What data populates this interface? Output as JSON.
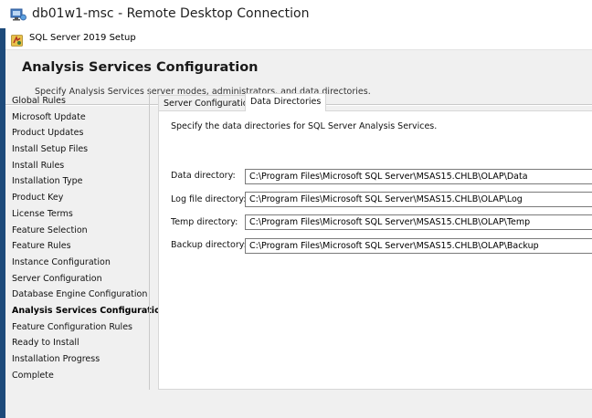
{
  "rdp": {
    "title": "db01w1-msc - Remote Desktop Connection"
  },
  "setup": {
    "window_title": "SQL Server 2019 Setup"
  },
  "header": {
    "title": "Analysis Services Configuration",
    "subtitle": "Specify Analysis Services server modes, administrators, and data directories."
  },
  "nav": {
    "items": [
      "Global Rules",
      "Microsoft Update",
      "Product Updates",
      "Install Setup Files",
      "Install Rules",
      "Installation Type",
      "Product Key",
      "License Terms",
      "Feature Selection",
      "Feature Rules",
      "Instance Configuration",
      "Server Configuration",
      "Database Engine Configuration",
      "Analysis Services Configuration",
      "Feature Configuration Rules",
      "Ready to Install",
      "Installation Progress",
      "Complete"
    ],
    "active": "Analysis Services Configuration"
  },
  "tabs": {
    "server_config": "Server Configuration",
    "data_dirs": "Data Directories"
  },
  "panel": {
    "instruction": "Specify the data directories for SQL Server Analysis Services.",
    "fields": [
      {
        "label": "Data directory:",
        "value": "C:\\Program Files\\Microsoft SQL Server\\MSAS15.CHLB\\OLAP\\Data"
      },
      {
        "label": "Log file directory:",
        "value": "C:\\Program Files\\Microsoft SQL Server\\MSAS15.CHLB\\OLAP\\Log"
      },
      {
        "label": "Temp directory:",
        "value": "C:\\Program Files\\Microsoft SQL Server\\MSAS15.CHLB\\OLAP\\Temp"
      },
      {
        "label": "Backup directory:",
        "value": "C:\\Program Files\\Microsoft SQL Server\\MSAS15.CHLB\\OLAP\\Backup"
      }
    ]
  },
  "icons": {
    "rdp": "remote-desktop-icon",
    "setup": "sql-setup-icon"
  }
}
